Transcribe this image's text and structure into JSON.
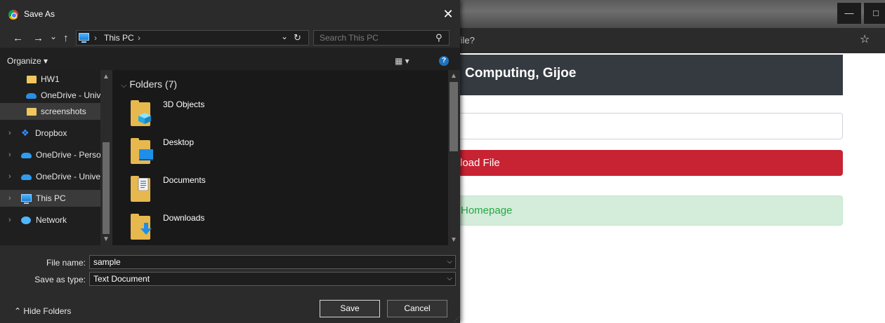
{
  "browser": {
    "address_text": "file?",
    "brand": "Computing, Gijoe",
    "danger_button": "load File",
    "alert_text": "Homepage",
    "star_icon": "star-icon",
    "minimize": "—",
    "restore": "□"
  },
  "dialog": {
    "title": "Save As",
    "close": "✕",
    "nav": {
      "back": "←",
      "forward": "→",
      "recent": "⌄",
      "up": "↑",
      "refresh": "↻",
      "dropdown": "⌄"
    },
    "path": {
      "location": "This PC",
      "sep": "›"
    },
    "search_placeholder": "Search This PC",
    "organize": "Organize ▾",
    "view": "▦ ▾",
    "help": "?",
    "nav_items": [
      {
        "label": "HW1",
        "icon": "folder-icon",
        "expander": ""
      },
      {
        "label": "OneDrive - Unive",
        "icon": "cloud-icon",
        "expander": ""
      },
      {
        "label": "screenshots",
        "icon": "folder-icon",
        "expander": ""
      },
      {
        "label": "Dropbox",
        "icon": "dropbox-icon",
        "expander": "›"
      },
      {
        "label": "OneDrive - Person",
        "icon": "cloud-icon",
        "expander": "›"
      },
      {
        "label": "OneDrive - Univer",
        "icon": "cloud-icon",
        "expander": "›"
      },
      {
        "label": "This PC",
        "icon": "pc-icon",
        "expander": "›"
      },
      {
        "label": "Network",
        "icon": "network-icon",
        "expander": "›"
      }
    ],
    "group_header": "Folders (7)",
    "folders": [
      {
        "label": "3D Objects",
        "icon": "3d-objects-folder-icon"
      },
      {
        "label": "Desktop",
        "icon": "desktop-folder-icon"
      },
      {
        "label": "Documents",
        "icon": "documents-folder-icon"
      },
      {
        "label": "Downloads",
        "icon": "downloads-folder-icon"
      }
    ],
    "file_name_label": "File name:",
    "file_name_value": "sample",
    "save_type_label": "Save as type:",
    "save_type_value": "Text Document",
    "hide_folders": "⌃  Hide Folders",
    "save_button": "Save",
    "cancel_button": "Cancel"
  }
}
